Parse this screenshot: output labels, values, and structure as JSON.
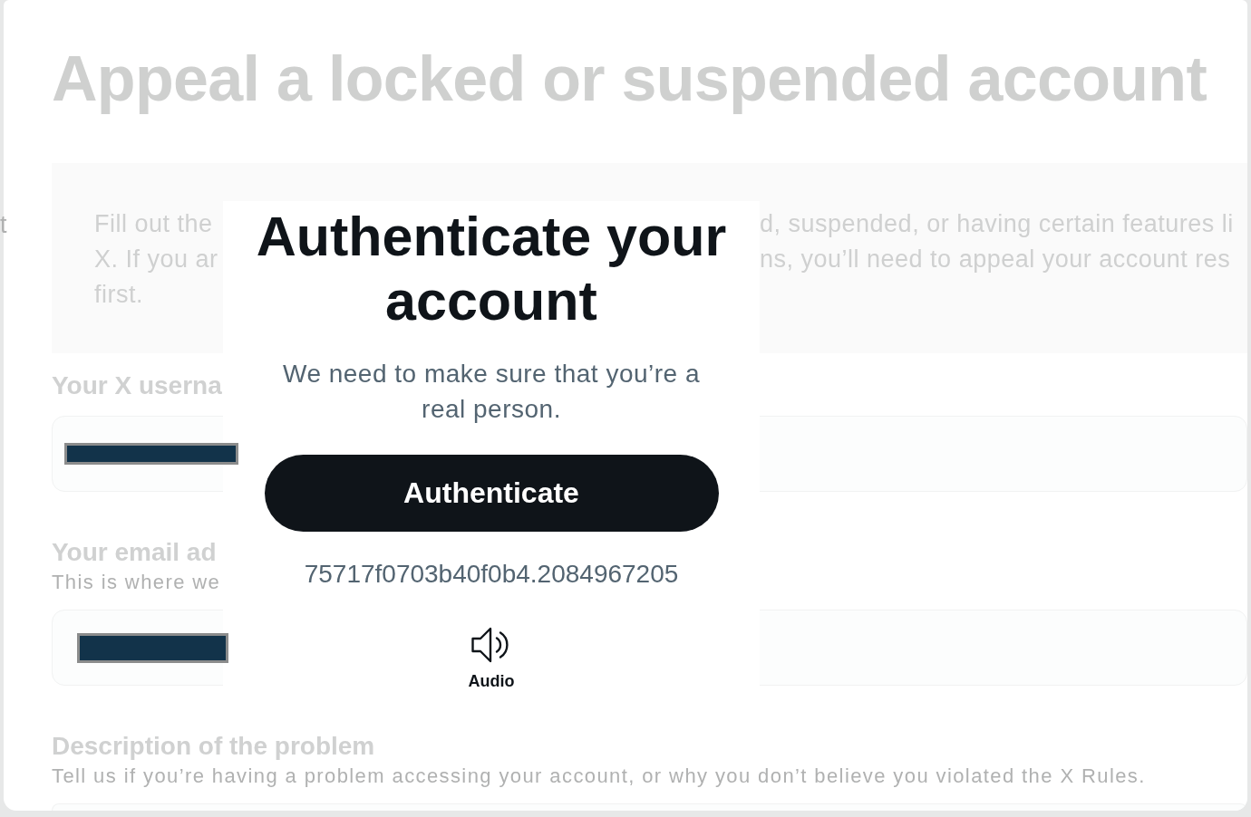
{
  "edge_fragment": "t",
  "page_title": "Appeal a locked or suspended account",
  "notice": {
    "left_lines": [
      "Fill out the",
      "X. If you ar",
      "first."
    ],
    "right_lines": [
      "d, suspended, or having certain features li",
      "ns, you’ll need to appeal your account res"
    ]
  },
  "fields": [
    {
      "kind": "input",
      "label": "Your X userna",
      "redacted": true
    },
    {
      "kind": "input",
      "label": "Your email ad",
      "hint": "This is where we",
      "redacted": true
    },
    {
      "kind": "textarea",
      "label": "Description of the problem",
      "hint": "Tell us if you’re having a problem accessing your account, or why you don’t believe you violated the X Rules."
    }
  ],
  "dialog": {
    "title": "Authenticate your account",
    "message": "We need to make sure that you’re a real person.",
    "button": "Authenticate",
    "code": "75717f0703b40f0b4.2084967205",
    "audio_label": "Audio"
  }
}
